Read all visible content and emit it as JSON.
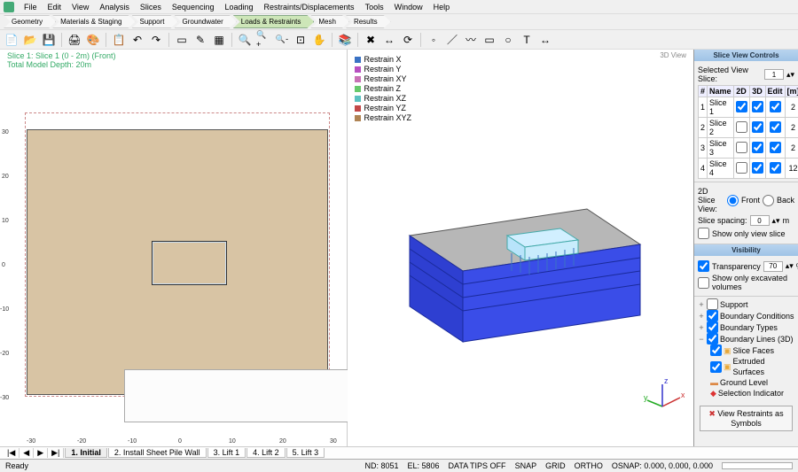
{
  "menu": [
    "File",
    "Edit",
    "View",
    "Analysis",
    "Slices",
    "Sequencing",
    "Loading",
    "Restraints/Displacements",
    "Tools",
    "Window",
    "Help"
  ],
  "breadcrumb": [
    {
      "label": "Geometry",
      "active": false
    },
    {
      "label": "Materials & Staging",
      "active": false
    },
    {
      "label": "Support",
      "active": false
    },
    {
      "label": "Groundwater",
      "active": false
    },
    {
      "label": "Loads & Restraints",
      "active": true
    },
    {
      "label": "Mesh",
      "active": false
    },
    {
      "label": "Results",
      "active": false
    }
  ],
  "viewport2d": {
    "title_line1": "Slice 1: Slice 1 (0 - 2m) (Front)",
    "title_line2": "Total Model Depth: 20m",
    "x_ticks": [
      "-30",
      "-20",
      "-10",
      "0",
      "10",
      "20",
      "30"
    ],
    "y_ticks": [
      "30",
      "20",
      "10",
      "0",
      "-10",
      "-20",
      "-30"
    ]
  },
  "viewport3d": {
    "label": "3D View"
  },
  "legend3d": [
    {
      "color": "#3a72c4",
      "label": "Restrain X"
    },
    {
      "color": "#b84fc0",
      "label": "Restrain Y"
    },
    {
      "color": "#c971b6",
      "label": "Restrain XY"
    },
    {
      "color": "#67c96c",
      "label": "Restrain Z"
    },
    {
      "color": "#5bc1c1",
      "label": "Restrain XZ"
    },
    {
      "color": "#c24848",
      "label": "Restrain YZ"
    },
    {
      "color": "#b08454",
      "label": "Restrain XYZ"
    }
  ],
  "side": {
    "header1": "Slice View Controls",
    "sel_slice_label": "Selected View Slice:",
    "sel_slice_val": "1",
    "table_head": [
      "#",
      "Name",
      "2D",
      "3D",
      "Edit",
      "[m]"
    ],
    "slices": [
      {
        "n": "1",
        "name": "Slice 1",
        "d2": true,
        "d3": true,
        "e": true,
        "m": "2"
      },
      {
        "n": "2",
        "name": "Slice 2",
        "d2": false,
        "d3": true,
        "e": true,
        "m": "2"
      },
      {
        "n": "3",
        "name": "Slice 3",
        "d2": false,
        "d3": true,
        "e": true,
        "m": "2"
      },
      {
        "n": "4",
        "name": "Slice 4",
        "d2": false,
        "d3": true,
        "e": true,
        "m": "12"
      }
    ],
    "view2d_label": "2D Slice View:",
    "front": "Front",
    "back": "Back",
    "spacing_label": "Slice spacing:",
    "spacing_val": "0",
    "spacing_unit": "m",
    "show_only": "Show only view slice",
    "header2": "Visibility",
    "transp_label": "Transparency",
    "transp_val": "70",
    "transp_unit": "%",
    "show_excav": "Show only excavated volumes",
    "tree": [
      {
        "label": "Support",
        "chk": false,
        "exp": "+"
      },
      {
        "label": "Boundary Conditions",
        "chk": true,
        "exp": "+"
      },
      {
        "label": "Boundary Types",
        "chk": true,
        "exp": "+"
      },
      {
        "label": "Boundary Lines (3D)",
        "chk": true,
        "exp": "−",
        "children": [
          {
            "label": "Slice Faces",
            "chk": true,
            "icon": "#e8a838"
          },
          {
            "label": "Extruded Surfaces",
            "chk": true,
            "icon": "#e8a838"
          },
          {
            "label": "Ground Level",
            "chk": false,
            "icon": "#d84"
          },
          {
            "label": "Selection Indicator",
            "chk": false,
            "icon": "#d33"
          }
        ]
      }
    ],
    "button": "View Restraints as Symbols"
  },
  "tabs": {
    "nav": [
      "|◀",
      "◀",
      "▶",
      "▶|"
    ],
    "items": [
      "1. Initial",
      "2. Install Sheet Pile Wall",
      "3. Lift 1",
      "4. Lift 2",
      "5. Lift 3"
    ],
    "active": 0
  },
  "status": {
    "left": "Ready",
    "nd": "ND: 8051",
    "el": "EL: 5806",
    "data": "DATA TIPS OFF",
    "snap": "SNAP",
    "grid": "GRID",
    "ortho": "ORTHO",
    "osnap": "OSNAP: 0.000, 0.000, 0.000"
  }
}
